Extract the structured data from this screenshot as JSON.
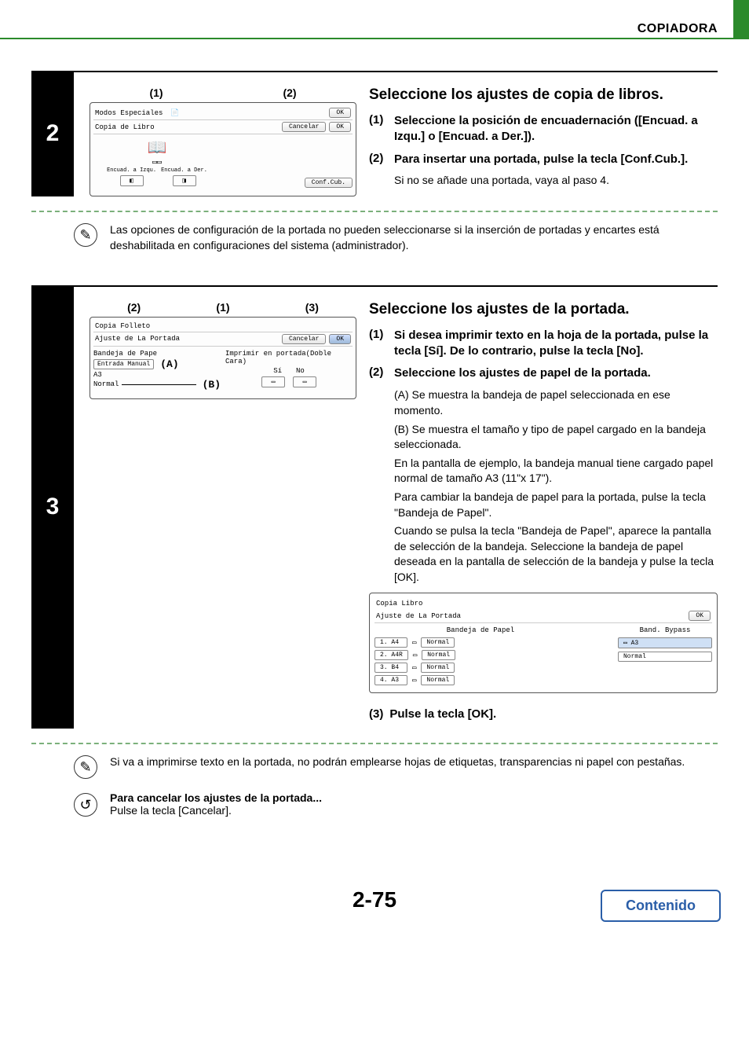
{
  "header": {
    "title": "COPIADORA"
  },
  "step2": {
    "number": "2",
    "callouts": [
      "(1)",
      "(2)"
    ],
    "panel": {
      "breadcrumb1": "Modos Especiales",
      "breadcrumb2": "Copia de Libro",
      "okTop": "OK",
      "cancel": "Cancelar",
      "ok": "OK",
      "bindLeft": "Encuad. a Izqu.",
      "bindRight": "Encuad. a Der.",
      "confCub": "Conf.Cub."
    },
    "title": "Seleccione los ajustes de copia de libros.",
    "items": [
      {
        "num": "(1)",
        "text": "Seleccione la posición de encuadernación ([Encuad. a Izqu.] o [Encuad. a Der.])."
      },
      {
        "num": "(2)",
        "text": "Para insertar una portada, pulse la tecla [Conf.Cub.]."
      }
    ],
    "note_under_item2": "Si no se añade una portada, vaya al paso 4.",
    "footnote": "Las opciones de configuración de la portada no pueden seleccionarse si la inserción de portadas y encartes está deshabilitada en configuraciones del sistema (administrador)."
  },
  "step3": {
    "number": "3",
    "callouts": [
      "(2)",
      "(1)",
      "(3)"
    ],
    "labelA": "(A)",
    "labelB": "(B)",
    "panel1": {
      "breadcrumb1": "Copia Folleto",
      "breadcrumb2": "Ajuste de La Portada",
      "cancel": "Cancelar",
      "ok": "OK",
      "trayLabel": "Bandeja de Pape",
      "printCover": "Imprimir en portada(Doble Cara)",
      "yes": "Sí",
      "no": "No",
      "entradaManual": "Entrada Manual",
      "a3": "A3",
      "normal": "Normal"
    },
    "title": "Seleccione los ajustes de la portada.",
    "items": [
      {
        "num": "(1)",
        "text": "Si desea imprimir texto en la hoja de la portada, pulse la tecla [Sí]. De lo contrario, pulse la tecla [No]."
      },
      {
        "num": "(2)",
        "text": "Seleccione los ajustes de papel de la portada."
      }
    ],
    "detailA": "(A) Se muestra la bandeja de papel seleccionada en ese momento.",
    "detailB": "(B) Se muestra el tamaño y tipo de papel cargado en la bandeja seleccionada.",
    "para1": "En la pantalla de ejemplo, la bandeja manual tiene cargado papel normal de tamaño A3 (11\"x 17\").",
    "para2": "Para cambiar la bandeja de papel para la portada, pulse la tecla \"Bandeja de Papel\".",
    "para3": "Cuando se pulsa la tecla \"Bandeja de Papel\", aparece la pantalla de selección de la bandeja. Seleccione la bandeja de papel deseada en la pantalla de selección de la bandeja y pulse la tecla [OK].",
    "panel2": {
      "breadcrumb1": "Copia Libro",
      "breadcrumb2": "Ajuste de La Portada",
      "ok": "OK",
      "trayHeader": "Bandeja de Papel",
      "bypassHeader": "Band. Bypass",
      "bypassSize": "A3",
      "bypassType": "Normal",
      "rows": [
        {
          "slot": "1.",
          "size": "A4",
          "type": "Normal"
        },
        {
          "slot": "2.",
          "size": "A4R",
          "type": "Normal"
        },
        {
          "slot": "3.",
          "size": "B4",
          "type": "Normal"
        },
        {
          "slot": "4.",
          "size": "A3",
          "type": "Normal"
        }
      ]
    },
    "item3": {
      "num": "(3)",
      "text": "Pulse la tecla [OK]."
    },
    "footnote": "Si va a imprimirse texto en la portada, no podrán emplearse hojas de etiquetas, transparencias ni papel con pestañas."
  },
  "cancel": {
    "title": "Para cancelar los ajustes de la portada...",
    "text": "Pulse la tecla [Cancelar]."
  },
  "footer": {
    "page": "2-75",
    "contenido": "Contenido"
  }
}
